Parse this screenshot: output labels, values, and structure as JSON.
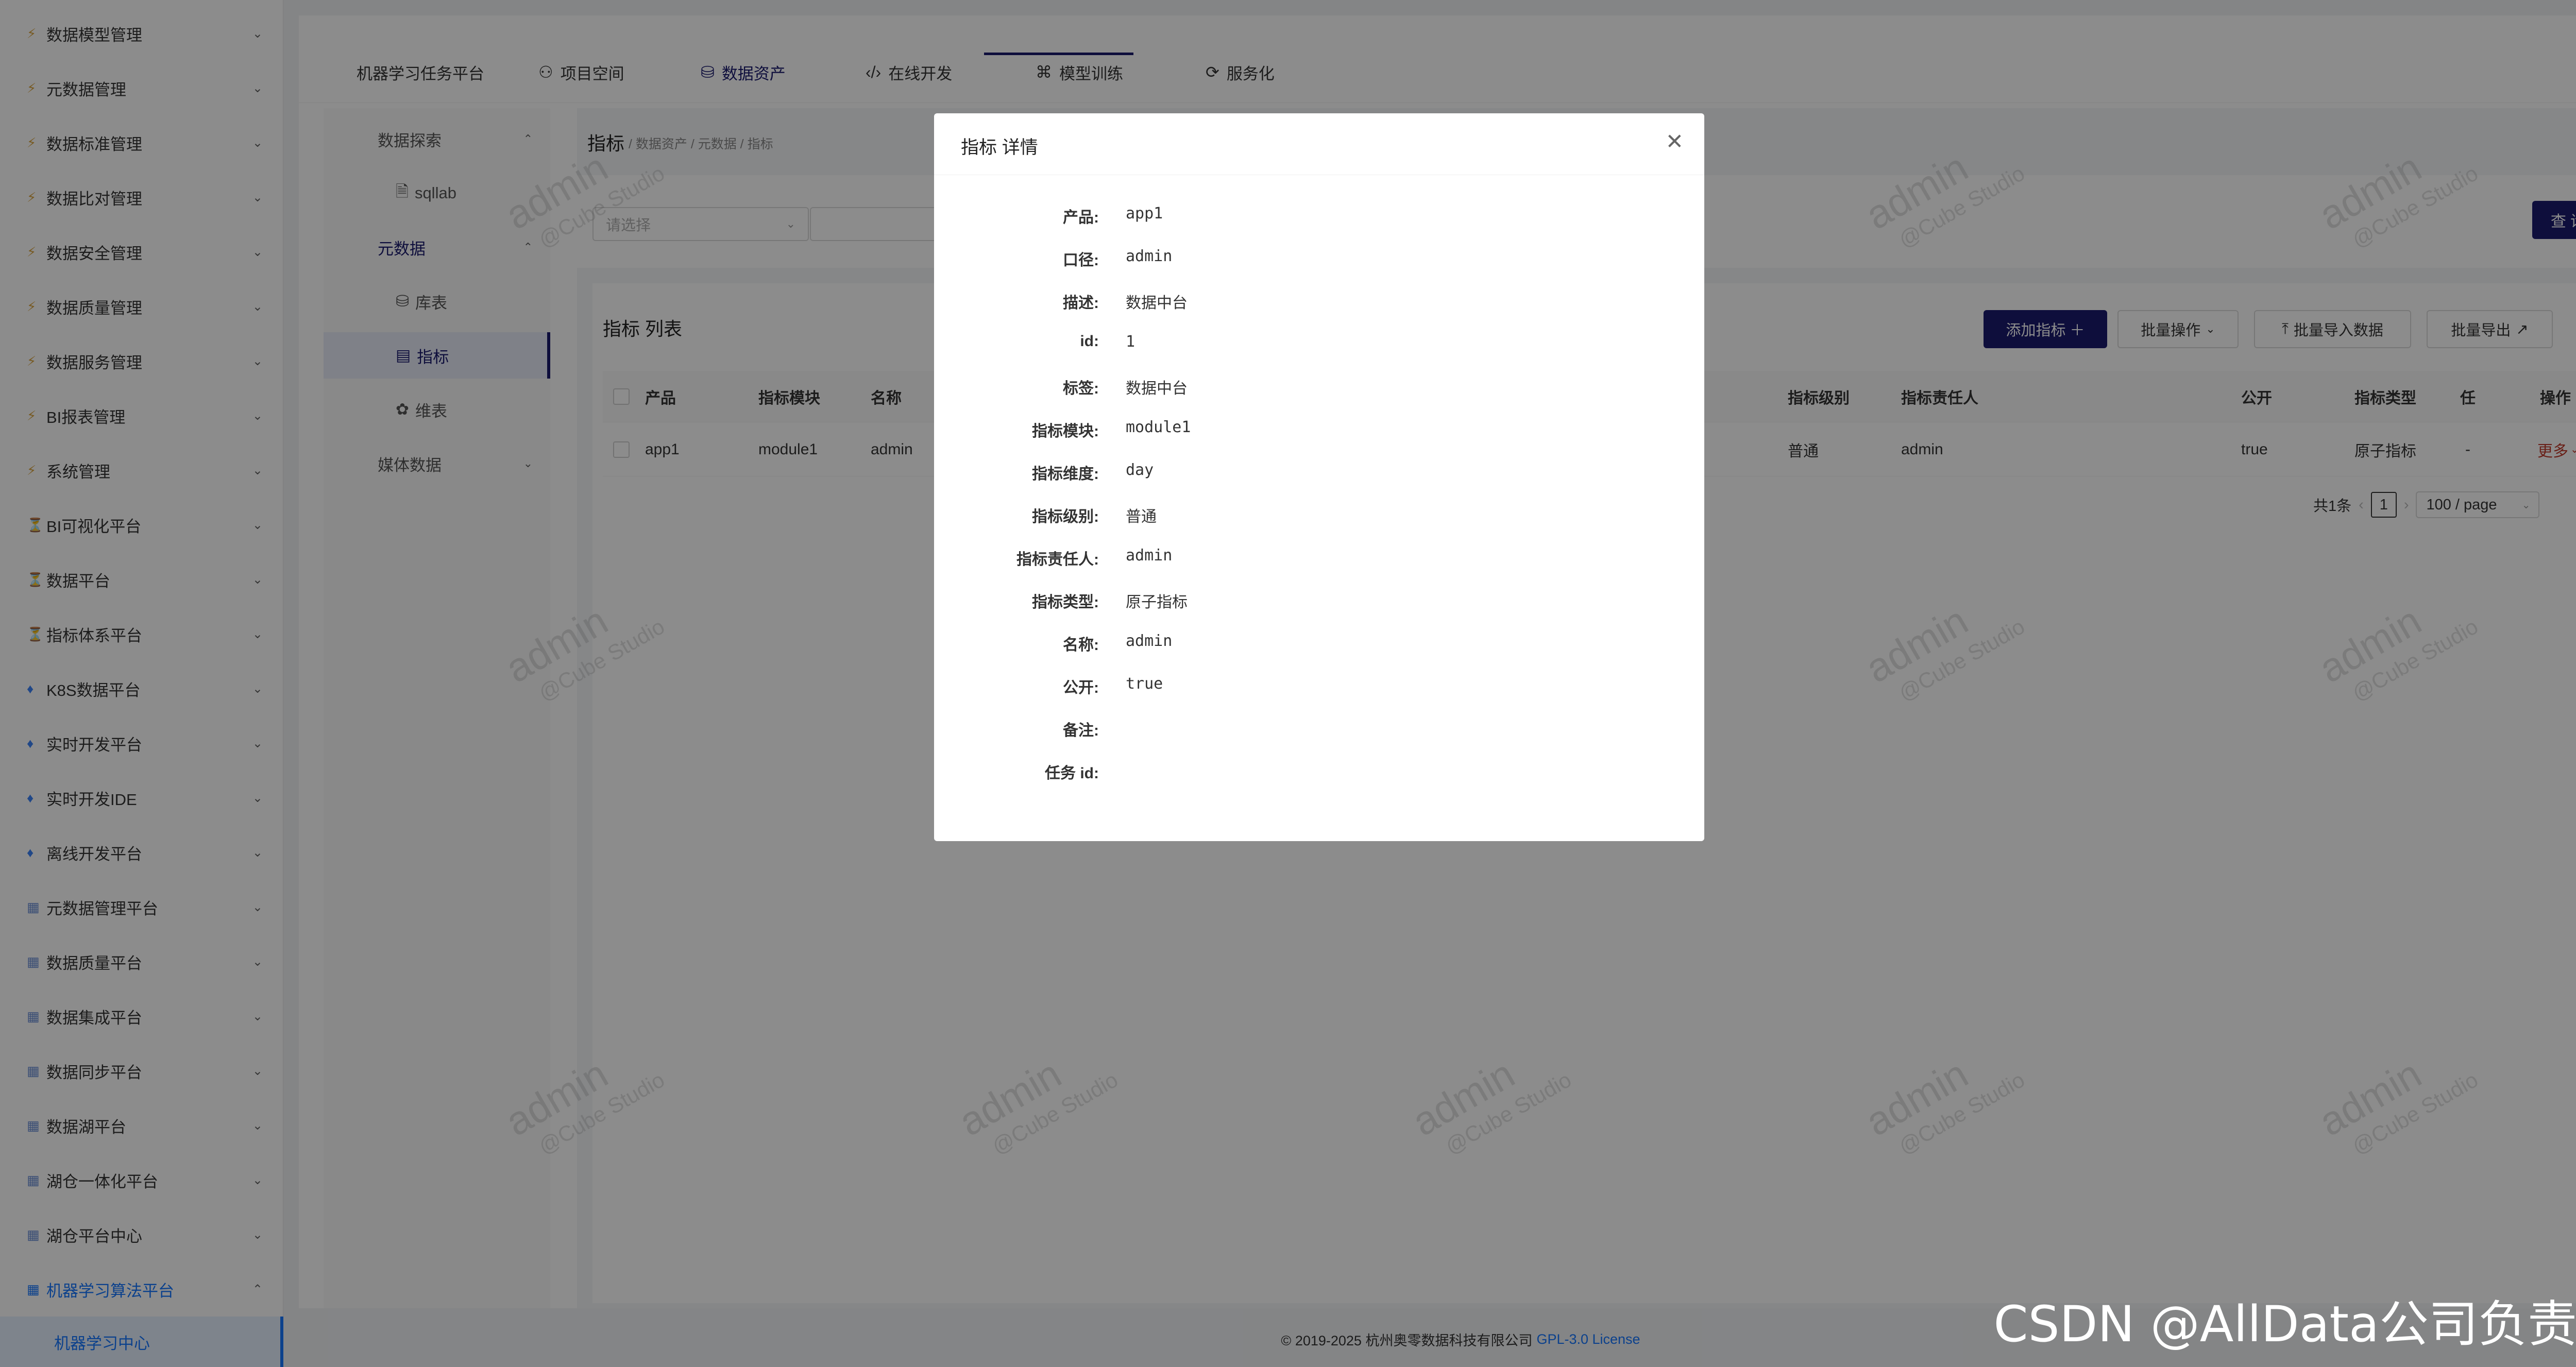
{
  "sidebar": {
    "items": [
      {
        "label": "数据模型管理",
        "icon": "lightning-icon"
      },
      {
        "label": "元数据管理",
        "icon": "lightning-icon"
      },
      {
        "label": "数据标准管理",
        "icon": "lightning-icon"
      },
      {
        "label": "数据比对管理",
        "icon": "lightning-icon"
      },
      {
        "label": "数据安全管理",
        "icon": "lightning-icon"
      },
      {
        "label": "数据质量管理",
        "icon": "lightning-icon"
      },
      {
        "label": "数据服务管理",
        "icon": "lightning-icon"
      },
      {
        "label": "BI报表管理",
        "icon": "lightning-icon"
      },
      {
        "label": "系统管理",
        "icon": "lightning-icon"
      },
      {
        "label": "BI可视化平台",
        "icon": "hourglass-icon"
      },
      {
        "label": "数据平台",
        "icon": "hourglass-icon"
      },
      {
        "label": "指标体系平台",
        "icon": "hourglass-icon"
      },
      {
        "label": "K8S数据平台",
        "icon": "diamond-icon"
      },
      {
        "label": "实时开发平台",
        "icon": "diamond-icon"
      },
      {
        "label": "实时开发IDE",
        "icon": "diamond-icon"
      },
      {
        "label": "离线开发平台",
        "icon": "diamond-icon"
      },
      {
        "label": "元数据管理平台",
        "icon": "grid-icon"
      },
      {
        "label": "数据质量平台",
        "icon": "grid-icon"
      },
      {
        "label": "数据集成平台",
        "icon": "grid-icon"
      },
      {
        "label": "数据同步平台",
        "icon": "grid-icon"
      },
      {
        "label": "数据湖平台",
        "icon": "grid-icon"
      },
      {
        "label": "湖仓一体化平台",
        "icon": "grid-icon"
      },
      {
        "label": "湖仓平台中心",
        "icon": "grid-icon"
      },
      {
        "label": "机器学习算法平台",
        "icon": "grid-icon"
      }
    ],
    "active_sub": "机器学习中心"
  },
  "topnav": {
    "tabs": [
      {
        "label": "机器学习任务平台",
        "icon": ""
      },
      {
        "label": "项目空间",
        "icon": "team-icon"
      },
      {
        "label": "数据资产",
        "icon": "database-icon"
      },
      {
        "label": "在线开发",
        "icon": "code-icon"
      },
      {
        "label": "模型训练",
        "icon": "training-icon"
      },
      {
        "label": "服务化",
        "icon": "service-icon"
      }
    ],
    "active": "数据资产"
  },
  "subnav": {
    "items": [
      {
        "label": "数据探索"
      },
      {
        "label": "sqllab"
      },
      {
        "label": "元数据"
      },
      {
        "label": "库表"
      },
      {
        "label": "指标"
      },
      {
        "label": "维表"
      },
      {
        "label": "媒体数据"
      }
    ]
  },
  "page": {
    "title": "指标",
    "breadcrumb": "/ 数据资产 / 元数据 / 指标",
    "select_placeholder": "请选择",
    "query_button": "查 询",
    "list_title": "指标 列表",
    "buttons": {
      "add": "添加指标 ＋",
      "batch": "批量操作",
      "import": "批量导入数据",
      "export": "批量导出"
    },
    "columns": {
      "product": "产品",
      "module": "指标模块",
      "name": "名称",
      "level": "指标级别",
      "owner": "指标责任人",
      "public": "公开",
      "type": "指标类型",
      "truncated": "任",
      "action": "操作"
    },
    "row": {
      "product": "app1",
      "module": "module1",
      "name": "admin",
      "level": "普通",
      "owner": "admin",
      "public": "true",
      "type": "原子指标",
      "truncated": "-",
      "action": "更多"
    },
    "pager": {
      "total": "共1条",
      "current": "1",
      "page_size": "100 / page"
    }
  },
  "watermark": {
    "line1": "admin",
    "line2": "@Cube Studio"
  },
  "footer": {
    "copyright": "© 2019-2025 杭州奥零数据科技有限公司",
    "license": "GPL-3.0 License"
  },
  "modal": {
    "title": "指标 详情",
    "fields": [
      {
        "label": "产品:",
        "value": "app1"
      },
      {
        "label": "口径:",
        "value": "admin"
      },
      {
        "label": "描述:",
        "value": "数据中台"
      },
      {
        "label": "id:",
        "value": "1"
      },
      {
        "label": "标签:",
        "value": "数据中台"
      },
      {
        "label": "指标模块:",
        "value": "module1"
      },
      {
        "label": "指标维度:",
        "value": "day"
      },
      {
        "label": "指标级别:",
        "value": "普通"
      },
      {
        "label": "指标责任人:",
        "value": "admin"
      },
      {
        "label": "指标类型:",
        "value": "原子指标"
      },
      {
        "label": "名称:",
        "value": "admin"
      },
      {
        "label": "公开:",
        "value": "true"
      },
      {
        "label": "备注:",
        "value": ""
      },
      {
        "label": "任务 id:",
        "value": ""
      }
    ]
  },
  "corner_text": "CSDN @AllData公司负责人"
}
